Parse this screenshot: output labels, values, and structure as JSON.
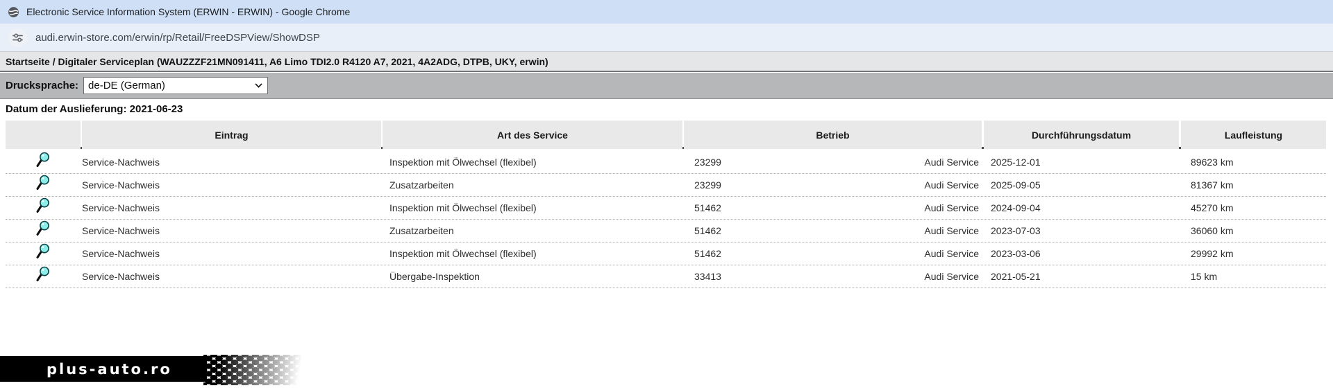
{
  "window": {
    "title": "Electronic Service Information System (ERWIN - ERWIN) - Google Chrome"
  },
  "browser": {
    "url": "audi.erwin-store.com/erwin/rp/Retail/FreeDSPView/ShowDSP"
  },
  "breadcrumb": "Startseite / Digitaler Serviceplan (WAUZZZF21MN091411, A6 Limo TDI2.0 R4120 A7, 2021, 4A2ADG, DTPB, UKY, erwin)",
  "controls": {
    "print_language_label": "Drucksprache:",
    "print_language_value": "de-DE (German)"
  },
  "delivery_date_line": "Datum der Auslieferung: 2021-06-23",
  "table": {
    "columns": [
      "",
      "Eintrag",
      "Art des Service",
      "Betrieb",
      "Durchführungsdatum",
      "Laufleistung"
    ],
    "rows": [
      {
        "entry": "Service-Nachweis",
        "service": "Inspektion mit Ölwechsel (flexibel)",
        "betrieb_nr": "23299",
        "betrieb_name": "Audi Service",
        "date": "2025-12-01",
        "mileage": "89623 km"
      },
      {
        "entry": "Service-Nachweis",
        "service": "Zusatzarbeiten",
        "betrieb_nr": "23299",
        "betrieb_name": "Audi Service",
        "date": "2025-09-05",
        "mileage": "81367 km"
      },
      {
        "entry": "Service-Nachweis",
        "service": "Inspektion mit Ölwechsel (flexibel)",
        "betrieb_nr": "51462",
        "betrieb_name": "Audi Service",
        "date": "2024-09-04",
        "mileage": "45270 km"
      },
      {
        "entry": "Service-Nachweis",
        "service": "Zusatzarbeiten",
        "betrieb_nr": "51462",
        "betrieb_name": "Audi Service",
        "date": "2023-07-03",
        "mileage": "36060 km"
      },
      {
        "entry": "Service-Nachweis",
        "service": "Inspektion mit Ölwechsel (flexibel)",
        "betrieb_nr": "51462",
        "betrieb_name": "Audi Service",
        "date": "2023-03-06",
        "mileage": "29992 km"
      },
      {
        "entry": "Service-Nachweis",
        "service": "Übergabe-Inspektion",
        "betrieb_nr": "33413",
        "betrieb_name": "Audi Service",
        "date": "2021-05-21",
        "mileage": "15 km"
      }
    ]
  },
  "watermark": {
    "text": "plus-auto.ro"
  },
  "icons": {
    "window_icon": "globe-icon",
    "url_icon": "site-settings-tune-icon",
    "select_icon": "chevron-down-icon",
    "row_icon": "magnifier-icon"
  },
  "colors": {
    "titlebar_bg": "#cfe0f6",
    "urlbar_bg": "#e9eff9",
    "breadcrumb_bg": "#e5e6e7",
    "toolbar_bg": "#b5b7b9",
    "header_cell_bg": "#e9e9e9",
    "header_border": "#4a4a4a",
    "magnifier_glass": "#8deee9",
    "watermark_bg": "#000000",
    "watermark_text": "#ffffff"
  }
}
